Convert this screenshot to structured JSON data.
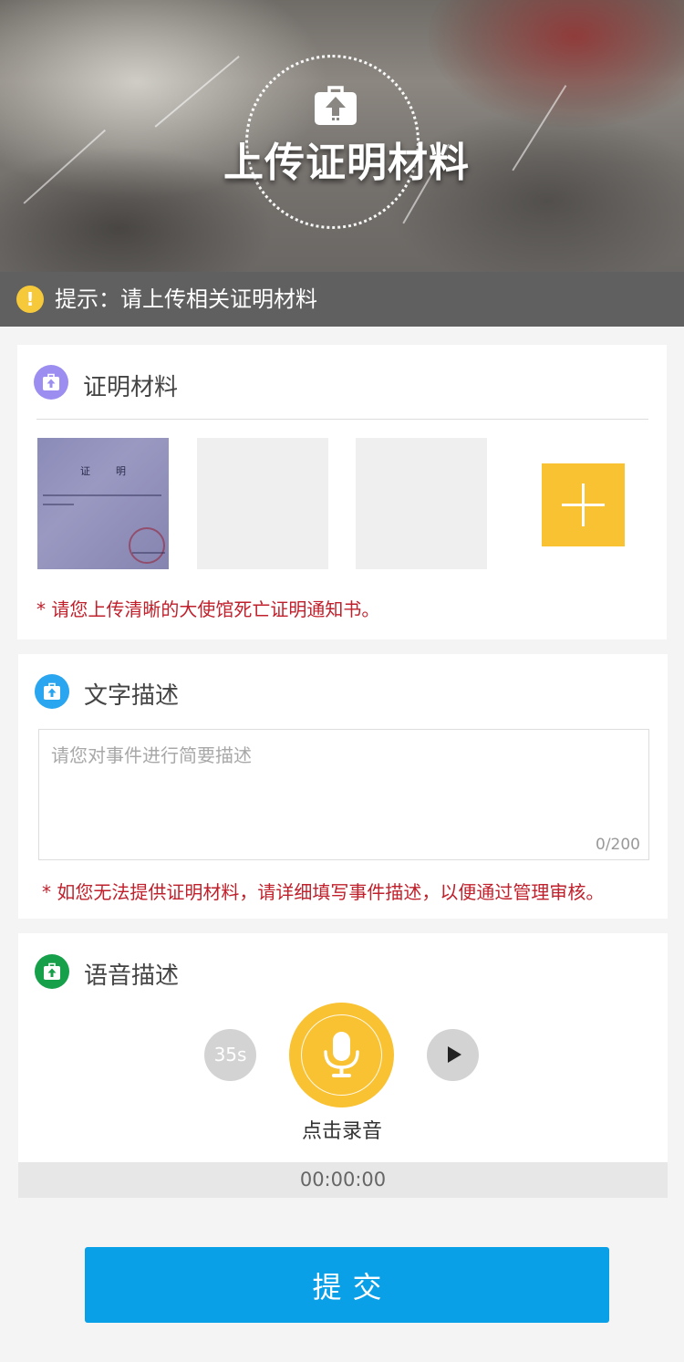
{
  "hero": {
    "title": "上传证明材料",
    "icon": "upload-briefcase-icon"
  },
  "tip": {
    "icon": "warning-icon",
    "text": "提示：请上传相关证明材料"
  },
  "proof_section": {
    "title": "证明材料",
    "icon": "upload-briefcase-icon",
    "icon_color": "#9b8ef0",
    "document": {
      "heading": "证明"
    },
    "add_icon": "plus-icon",
    "note": "* 请您上传清晰的大使馆死亡证明通知书。"
  },
  "text_section": {
    "title": "文字描述",
    "icon": "upload-briefcase-icon",
    "icon_color": "#2aa5f0",
    "placeholder": "请您对事件进行简要描述",
    "value": "",
    "counter": "0/200",
    "note": "* 如您无法提供证明材料，请详细填写事件描述，以便通过管理审核。"
  },
  "voice_section": {
    "title": "语音描述",
    "icon": "upload-briefcase-icon",
    "icon_color": "#17a04a",
    "duration": "35s",
    "mic_icon": "microphone-icon",
    "play_icon": "play-icon",
    "record_label": "点击录音",
    "timer": "00:00:00"
  },
  "submit_label": "提交",
  "colors": {
    "accent_yellow": "#f9c232",
    "submit_blue": "#0aa0e8",
    "note_red": "#c0202b",
    "tip_bar": "#606060"
  }
}
